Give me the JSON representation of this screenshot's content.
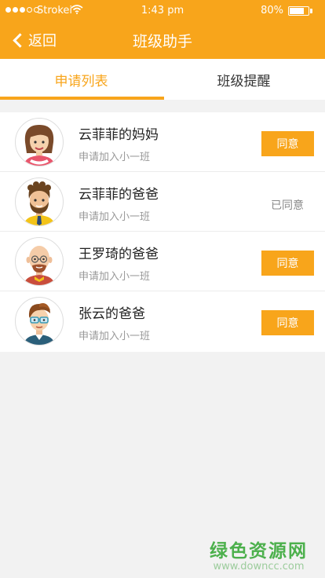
{
  "status_bar": {
    "carrier": "Strokei",
    "time": "1:43 pm",
    "battery": "80%",
    "battery_level": 0.8
  },
  "nav": {
    "back_label": "返回",
    "title": "班级助手"
  },
  "tabs": [
    {
      "label": "申请列表",
      "active": true
    },
    {
      "label": "班级提醒",
      "active": false
    }
  ],
  "requests": [
    {
      "name": "云菲菲的妈妈",
      "subtitle": "申请加入小一班",
      "action": "同意",
      "avatar": "woman-avatar-icon"
    },
    {
      "name": "云菲菲的爸爸",
      "subtitle": "申请加入小一班",
      "status": "已同意",
      "avatar": "bearded-man-avatar-icon"
    },
    {
      "name": "王罗琦的爸爸",
      "subtitle": "申请加入小一班",
      "action": "同意",
      "avatar": "bald-man-avatar-icon"
    },
    {
      "name": "张云的爸爸",
      "subtitle": "申请加入小一班",
      "action": "同意",
      "avatar": "glasses-man-avatar-icon"
    }
  ],
  "watermark": {
    "text": "绿色资源网",
    "url": "www.downcc.com"
  },
  "colors": {
    "accent": "#f8a51b",
    "watermark": "#4cb04c"
  }
}
